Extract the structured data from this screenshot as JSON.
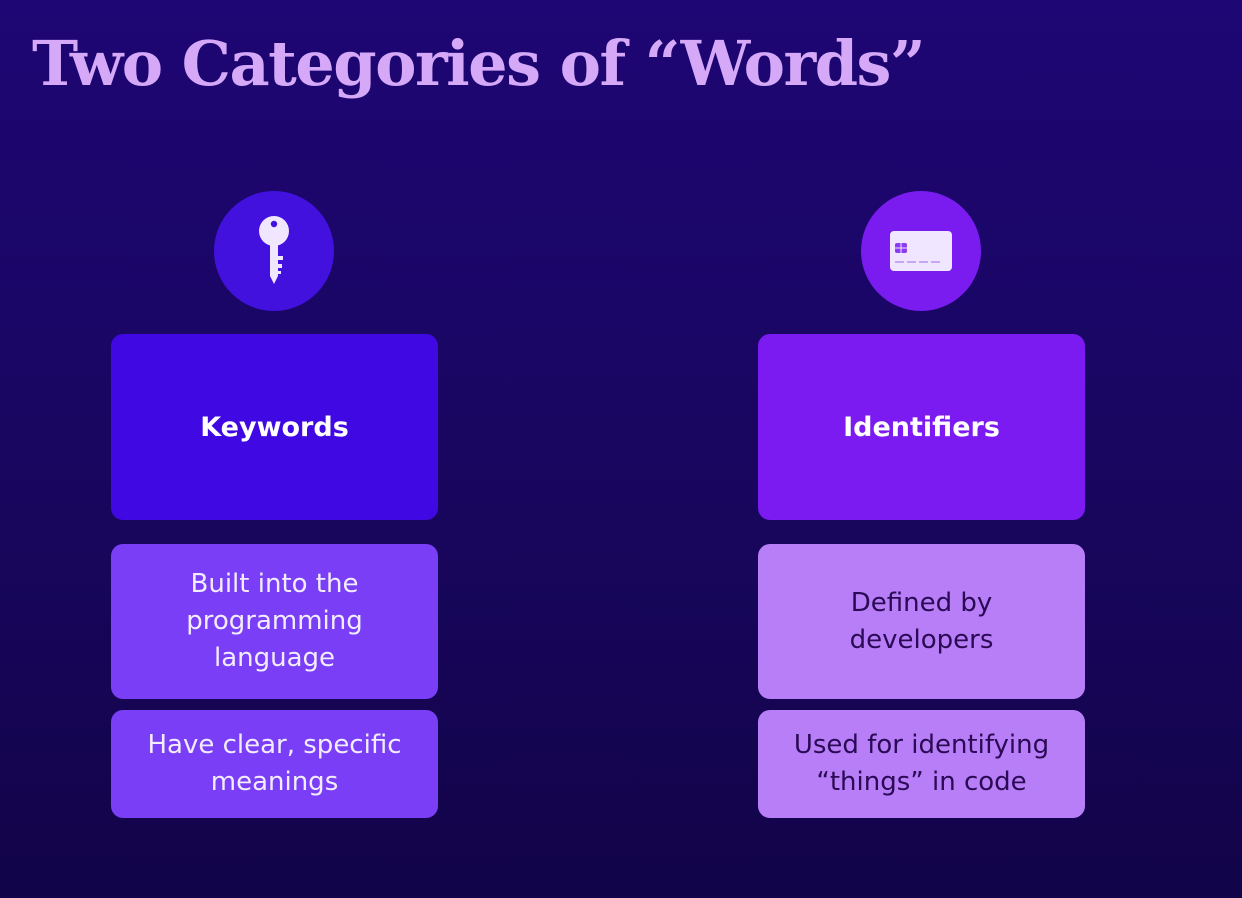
{
  "slide": {
    "title": "Two Categories of “Words”"
  },
  "columns": [
    {
      "icon": "key-icon",
      "heading": "Keywords",
      "points": [
        "Built into the programming language",
        "Have clear, specific meanings"
      ]
    },
    {
      "icon": "id-card-icon",
      "heading": "Identifiers",
      "points": [
        "Defined by developers",
        "Used for identifying “things” in code"
      ]
    }
  ],
  "colors": {
    "background": "#1a0666",
    "title": "#d5a8f8",
    "keywords_circle": "#4211de",
    "keywords_heading": "#4008e2",
    "keywords_points": "#7a3ef6",
    "identifiers_circle": "#7a1cf0",
    "identifiers_heading": "#7c1af2",
    "identifiers_points": "#b87ef8"
  }
}
